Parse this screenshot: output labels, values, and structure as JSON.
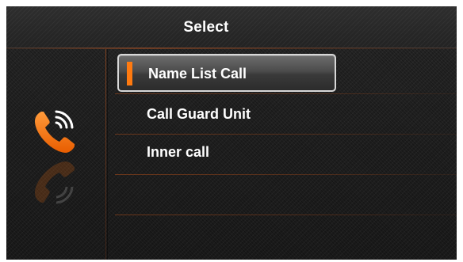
{
  "header": {
    "title": "Select"
  },
  "menu": {
    "items": [
      {
        "label": "Name List Call",
        "selected": true
      },
      {
        "label": "Call Guard Unit",
        "selected": false
      },
      {
        "label": "Inner call",
        "selected": false
      }
    ]
  },
  "icons": {
    "side_icon": "phone-call-icon"
  },
  "colors": {
    "accent": "#ff7a10",
    "background": "#222222",
    "text": "#ffffff"
  }
}
